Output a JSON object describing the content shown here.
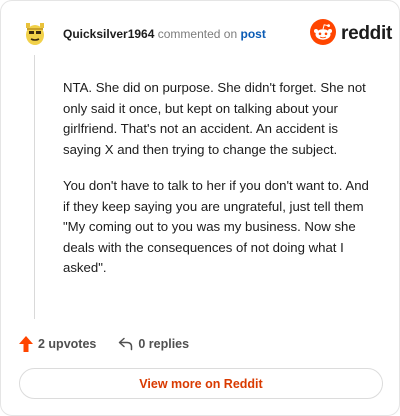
{
  "comment": {
    "username": "Quicksilver1964",
    "action_text": "commented on",
    "post_link": "post",
    "paragraphs": [
      "NTA. She did on purpose. She didn't forget. She not only said it once, but kept on talking about your girlfriend. That's not an accident. An accident is saying X and then trying to change the subject.",
      "You don't have to talk to her if you don't want to. And if they keep saying you are ungrateful, just tell them \"My coming out to you was my business. Now she deals with the consequences of not doing what I asked\"."
    ]
  },
  "brand": {
    "logo_text": "reddit",
    "accent_color": "#ff4500"
  },
  "footer": {
    "upvotes_label": "2 upvotes",
    "replies_label": "0 replies",
    "view_more_label": "View more on Reddit"
  },
  "icons": {
    "avatar": "snoo-avatar-icon",
    "logo": "reddit-logo-icon",
    "upvote": "upvote-arrow-icon",
    "reply": "reply-arrow-icon"
  }
}
